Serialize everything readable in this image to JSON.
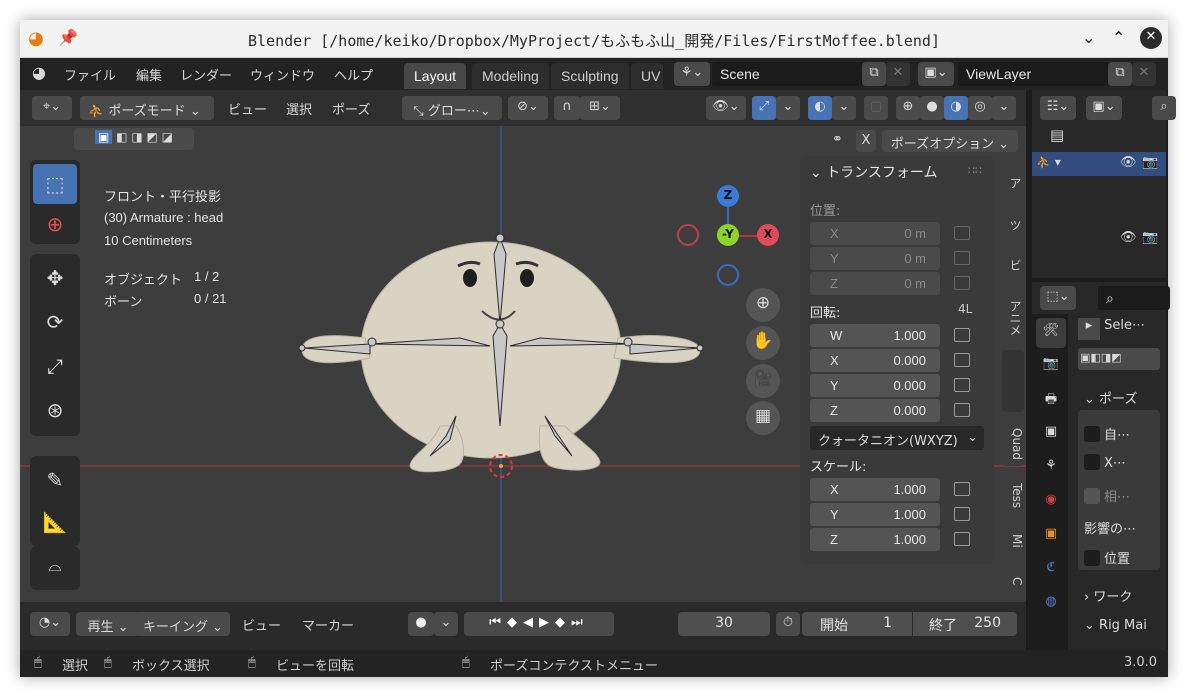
{
  "window": {
    "title": "Blender [/home/keiko/Dropbox/MyProject/もふもふ山_開発/Files/FirstMoffee.blend]"
  },
  "menu": {
    "items": [
      "ファイル",
      "編集",
      "レンダー",
      "ウィンドウ",
      "ヘルプ"
    ],
    "tabs": [
      "Layout",
      "Modeling",
      "Sculpting",
      "UV"
    ],
    "scene": "Scene",
    "view_layer": "ViewLayer"
  },
  "viewport_header": {
    "mode": "ポーズモード",
    "menus": [
      "ビュー",
      "選択",
      "ポーズ"
    ],
    "transform_orientation": "グロー⋯",
    "pose_options": "ポーズオプション",
    "x_toggle": "X"
  },
  "overlay_info": {
    "view": "フロント・平行投影",
    "object": "(30) Armature : head",
    "scale": "10 Centimeters",
    "objects_label": "オブジェクト",
    "objects_value": "1 / 2",
    "bones_label": "ボーン",
    "bones_value": "0 / 21"
  },
  "gizmo": {
    "z": "Z",
    "y": "-Y",
    "x": "X"
  },
  "transform_panel": {
    "title": "トランスフォーム",
    "location_label": "位置:",
    "location": [
      {
        "axis": "X",
        "value": "0 m"
      },
      {
        "axis": "Y",
        "value": "0 m"
      },
      {
        "axis": "Z",
        "value": "0 m"
      }
    ],
    "rotation_label": "回転:",
    "rotation_badge": "4L",
    "rotation": [
      {
        "axis": "W",
        "value": "1.000"
      },
      {
        "axis": "X",
        "value": "0.000"
      },
      {
        "axis": "Y",
        "value": "0.000"
      },
      {
        "axis": "Z",
        "value": "0.000"
      }
    ],
    "rotation_mode": "クォータニオン(WXYZ)",
    "scale_label": "スケール:",
    "scale": [
      {
        "axis": "X",
        "value": "1.000"
      },
      {
        "axis": "Y",
        "value": "1.000"
      },
      {
        "axis": "Z",
        "value": "1.000"
      }
    ]
  },
  "sidebar_tabs": [
    "ア",
    "ツ",
    "ビ",
    "アニメ",
    "Quad",
    "Tess",
    "Mi",
    "C"
  ],
  "properties": {
    "select_label": "Sele⋯",
    "pose_section": "ポーズ",
    "items": [
      "自⋯",
      "X⋯",
      "相⋯"
    ],
    "affect_label": "影響の⋯",
    "location_toggle": "位置",
    "workspace_section": "ワーク",
    "rig_section": "Rig Mai"
  },
  "timeline": {
    "playback": "再生",
    "keying": "キーイング",
    "view": "ビュー",
    "marker": "マーカー",
    "current_frame": "30",
    "start_label": "開始",
    "start_value": "1",
    "end_label": "終了",
    "end_value": "250"
  },
  "statusbar": {
    "select": "選択",
    "box_select": "ボックス選択",
    "rotate_view": "ビューを回転",
    "context_menu": "ポーズコンテクストメニュー",
    "version": "3.0.0"
  }
}
